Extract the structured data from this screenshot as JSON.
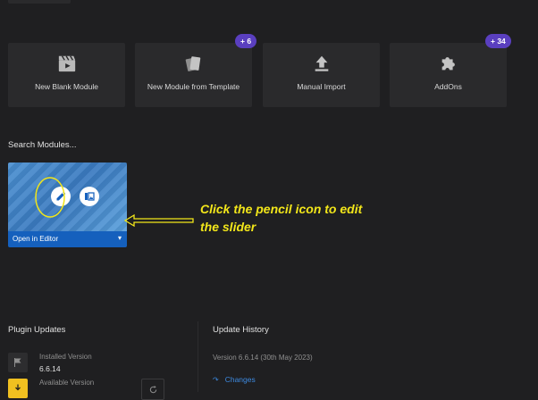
{
  "tiles": [
    {
      "label": "New Blank Module",
      "icon": "clapperboard-icon"
    },
    {
      "label": "New Module from Template",
      "icon": "template-icon",
      "badge": "+ 6"
    },
    {
      "label": "Manual Import",
      "icon": "upload-icon"
    },
    {
      "label": "AddOns",
      "icon": "puzzle-icon",
      "badge": "+ 34"
    }
  ],
  "search_modules_title": "Search Modules...",
  "module": {
    "open_label": "Open in Editor",
    "edit_icon": "pencil-icon",
    "media_icon": "image-icon"
  },
  "annotation": {
    "text": "Click the pencil icon to edit the slider",
    "color": "#f2e61a"
  },
  "plugin_updates": {
    "title": "Plugin Updates",
    "installed_label": "Installed Version",
    "installed_value": "6.6.14",
    "available_label": "Available Version"
  },
  "update_history": {
    "title": "Update History",
    "version_line": "Version 6.6.14 (30th May 2023)",
    "changes_label": "Changes"
  },
  "colors": {
    "background": "#1f1f21",
    "tile": "#2a2a2c",
    "badge": "#5a3fbf",
    "accent_blue": "#1560bd",
    "link": "#3d8ae0"
  }
}
